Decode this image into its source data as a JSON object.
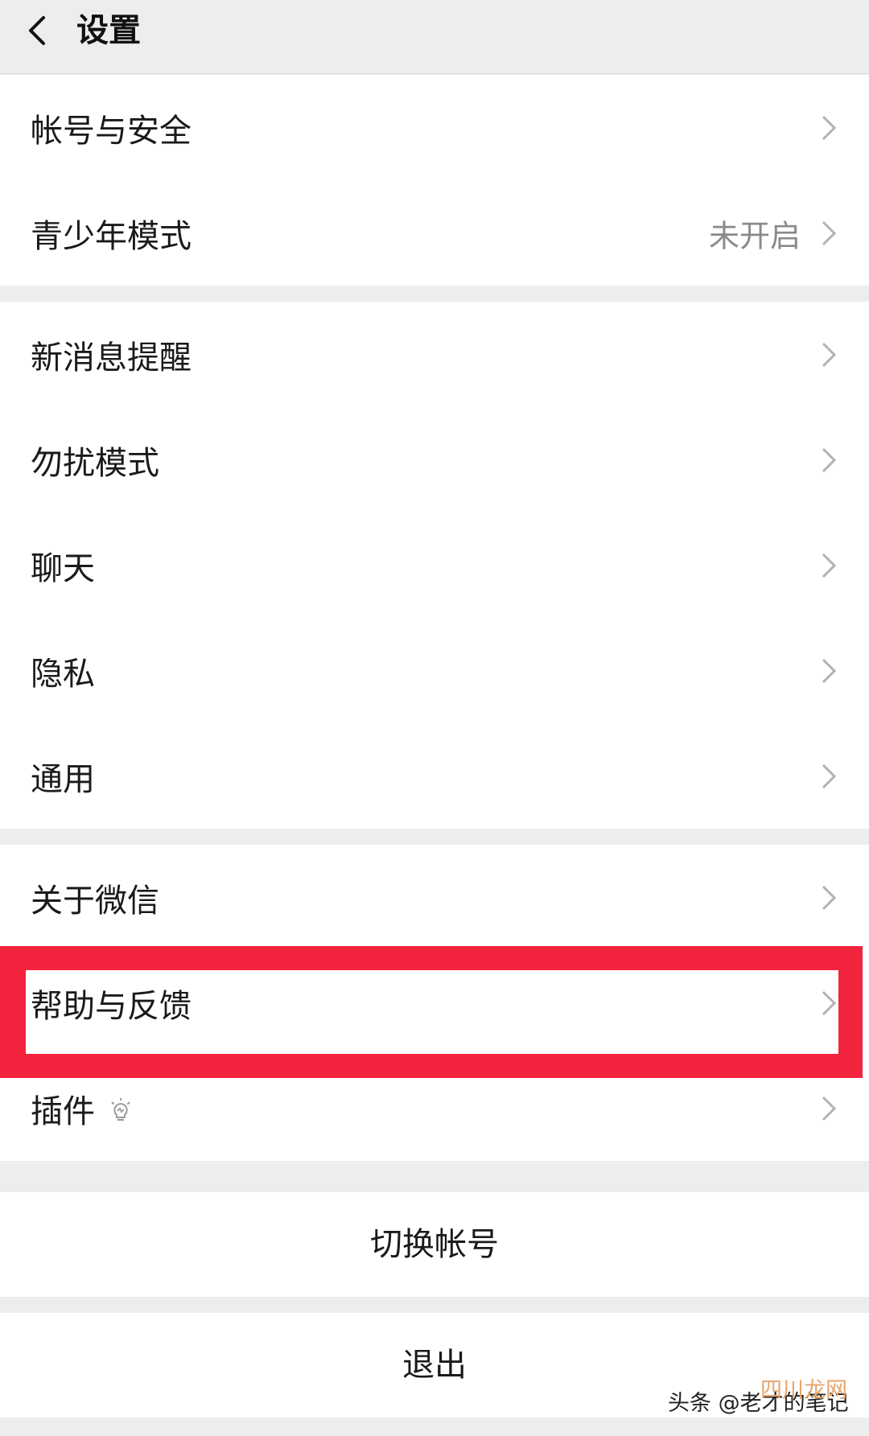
{
  "header": {
    "title": "设置",
    "back_icon": "chevron-left-icon"
  },
  "groups": [
    {
      "items": [
        {
          "label": "帐号与安全",
          "value": ""
        },
        {
          "label": "青少年模式",
          "value": "未开启"
        }
      ]
    },
    {
      "items": [
        {
          "label": "新消息提醒",
          "value": ""
        },
        {
          "label": "勿扰模式",
          "value": ""
        },
        {
          "label": "聊天",
          "value": ""
        },
        {
          "label": "隐私",
          "value": ""
        },
        {
          "label": "通用",
          "value": ""
        }
      ]
    },
    {
      "items": [
        {
          "label": "关于微信",
          "value": ""
        },
        {
          "label": "帮助与反馈",
          "value": ""
        },
        {
          "label": "插件",
          "value": "",
          "icon": "lightbulb-icon"
        }
      ]
    }
  ],
  "actions": {
    "switch_account": "切换帐号",
    "logout": "退出"
  },
  "highlight": {
    "target": "帮助与反馈",
    "color": "#f2243e"
  },
  "watermark": {
    "text": "头条 @老才的笔记",
    "overlay": "四川龙网"
  },
  "colors": {
    "background": "#ededed",
    "cell": "#ffffff",
    "secondary_text": "#8a8a8a",
    "chevron": "#b2b2b2"
  }
}
